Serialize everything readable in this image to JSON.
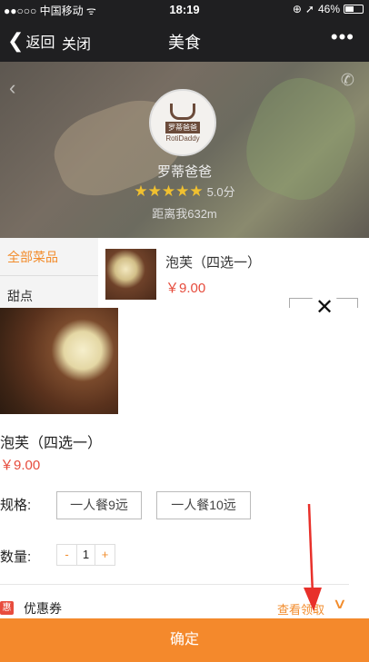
{
  "status_bar": {
    "carrier": "●●○○○ 中国移动 ᯤ",
    "time": "18:19",
    "battery_text": "46%",
    "icons": [
      "lock-rotation-icon",
      "location-arrow-icon",
      "battery-icon"
    ]
  },
  "nav": {
    "back_label": "返回",
    "close_label": "关闭",
    "title": "美食",
    "more_label": "•••"
  },
  "store": {
    "logo_cn": "罗蒂爸爸",
    "logo_en": "RotiDaddy",
    "name": "罗蒂爸爸",
    "stars": "★★★★★",
    "score": "5.0分",
    "distance": "距离我632m"
  },
  "menu": {
    "categories": [
      "全部菜品",
      "甜点"
    ],
    "dish_name": "泡芙（四选一）",
    "dish_price": "￥9.00"
  },
  "modal": {
    "product_name": "泡芙（四选一）",
    "product_price": "￥9.00",
    "spec_label": "规格:",
    "spec_options": [
      "一人餐9远",
      "一人餐10远"
    ],
    "qty_label": "数量:",
    "qty_minus": "-",
    "qty_value": "1",
    "qty_plus": "+",
    "coupon_badge": "惠",
    "coupon_label": "优惠券",
    "coupon_link": "查看领取",
    "confirm_label": "确定"
  },
  "colors": {
    "accent": "#f4892c",
    "price": "#e64b3c",
    "annotation": "#e8302a"
  }
}
